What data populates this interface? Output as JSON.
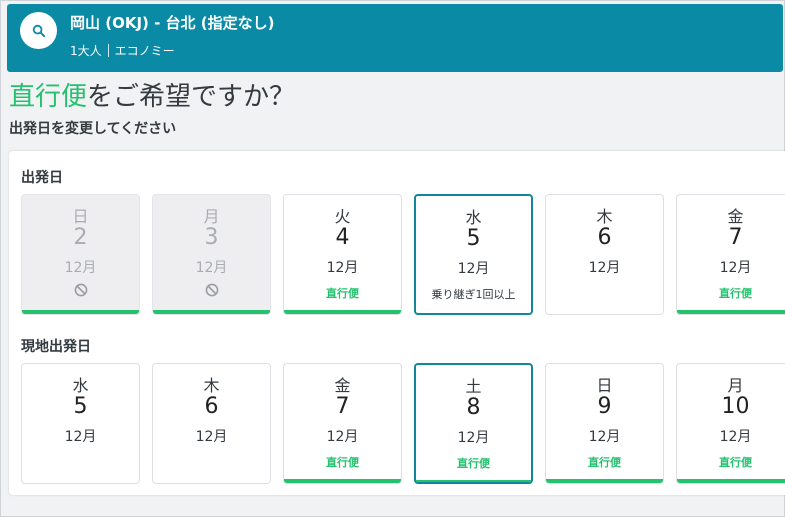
{
  "header": {
    "route": "岡山 (OKJ) - 台北 (指定なし)",
    "passengers": "1大人",
    "cabin": "エコノミー",
    "icons": {
      "search": "search-icon"
    }
  },
  "headline": {
    "highlight": "直行便",
    "rest": "をご希望ですか？"
  },
  "subheading": "出発日を変更してください",
  "colors": {
    "brand": "#0b8aa6",
    "direct": "#25c16f",
    "selected": "#12869d"
  },
  "outbound": {
    "label": "出発日",
    "days": [
      {
        "dow": "日",
        "day": "2",
        "month": "12月",
        "status": "unavailable",
        "tag": "",
        "bar": true
      },
      {
        "dow": "月",
        "day": "3",
        "month": "12月",
        "status": "unavailable",
        "tag": "",
        "bar": true
      },
      {
        "dow": "火",
        "day": "4",
        "month": "12月",
        "status": "direct",
        "tag": "直行便",
        "bar": true
      },
      {
        "dow": "水",
        "day": "5",
        "month": "12月",
        "status": "connect",
        "tag": "乗り継ぎ1回以上",
        "bar": false,
        "selected": true
      },
      {
        "dow": "木",
        "day": "6",
        "month": "12月",
        "status": "none",
        "tag": "",
        "bar": false
      },
      {
        "dow": "金",
        "day": "7",
        "month": "12月",
        "status": "direct",
        "tag": "直行便",
        "bar": true
      }
    ]
  },
  "return": {
    "label": "現地出発日",
    "days": [
      {
        "dow": "水",
        "day": "5",
        "month": "12月",
        "status": "none",
        "tag": "",
        "bar": false
      },
      {
        "dow": "木",
        "day": "6",
        "month": "12月",
        "status": "none",
        "tag": "",
        "bar": false
      },
      {
        "dow": "金",
        "day": "7",
        "month": "12月",
        "status": "direct",
        "tag": "直行便",
        "bar": true
      },
      {
        "dow": "土",
        "day": "8",
        "month": "12月",
        "status": "direct",
        "tag": "直行便",
        "bar": true,
        "selected": true
      },
      {
        "dow": "日",
        "day": "9",
        "month": "12月",
        "status": "direct",
        "tag": "直行便",
        "bar": true
      },
      {
        "dow": "月",
        "day": "10",
        "month": "12月",
        "status": "direct",
        "tag": "直行便",
        "bar": true
      }
    ]
  }
}
